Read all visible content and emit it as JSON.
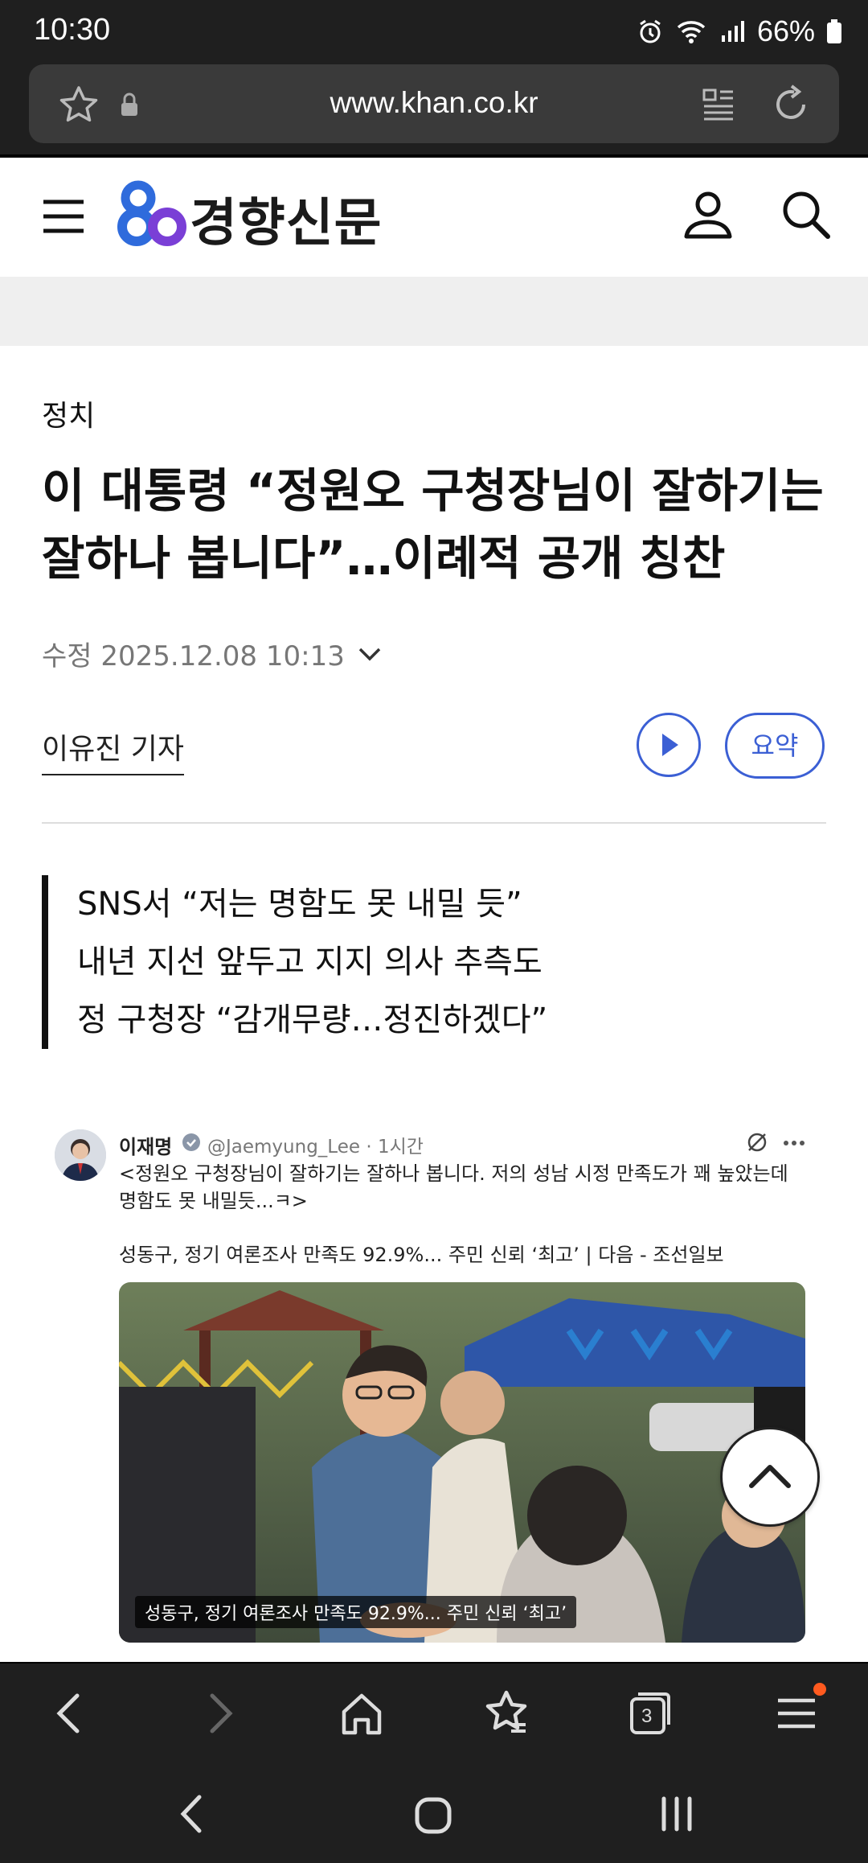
{
  "status_bar": {
    "time": "10:30",
    "battery": "66%"
  },
  "browser": {
    "url": "www.khan.co.kr",
    "tab_count": "3"
  },
  "site": {
    "logo_text": "경향신문"
  },
  "article": {
    "category": "정치",
    "headline_line1": "이 대통령 “정원오 구청장님이 잘하기는",
    "headline_line2": "잘하나 봅니다”…이례적 공개 칭찬",
    "dateline": "수정 2025.12.08 10:13",
    "author": "이유진 기자",
    "summary_button": "요약",
    "subheads": [
      "SNS서 “저는 명함도 못 내밀 듯”",
      "내년 지선 앞두고 지지 의사 추측도",
      "정 구청장 “감개무량…정진하겠다”"
    ]
  },
  "tweet": {
    "name": "이재명",
    "handle": "@Jaemyung_Lee · 1시간",
    "text": "<정원오 구청장님이 잘하기는 잘하나 봅니다. 저의 성남 시정 만족도가 꽤 높았는데 명함도 못 내밀듯...ㅋ>",
    "link_title": "성동구, 정기 여론조사 만족도 92.9%... 주민 신뢰 ‘최고’ | 다음 - 조선일보",
    "photo_caption": "성동구, 정기 여론조사 만족도 92.9%... 주민 신뢰 ‘최고’"
  },
  "colors": {
    "accent": "#3b5fd4",
    "logo_blue": "#2f6bdc",
    "logo_purple": "#7a3fd6",
    "notification_dot": "#ff5a1f"
  }
}
